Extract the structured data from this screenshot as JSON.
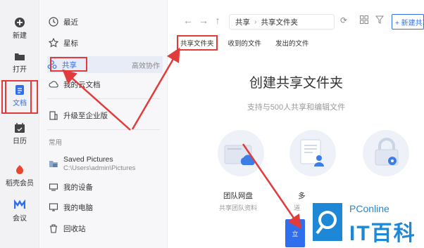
{
  "rail": {
    "items": [
      {
        "label": "新建",
        "icon": "plus-circle-icon"
      },
      {
        "label": "打开",
        "icon": "folder-icon"
      },
      {
        "label": "文档",
        "icon": "document-icon"
      },
      {
        "label": "日历",
        "icon": "calendar-icon"
      },
      {
        "label": "稻壳会员",
        "icon": "member-icon"
      },
      {
        "label": "会议",
        "icon": "meeting-icon"
      }
    ]
  },
  "sidebar": {
    "items": [
      {
        "label": "最近",
        "icon": "clock-icon"
      },
      {
        "label": "星标",
        "icon": "star-icon"
      },
      {
        "label": "共享",
        "icon": "share-icon",
        "extra": "高效协作"
      },
      {
        "label": "我的云文档",
        "icon": "cloud-icon"
      },
      {
        "label": "升级至企业版",
        "icon": "building-icon"
      }
    ],
    "section_label": "常用",
    "section_more": "⋮",
    "common": [
      {
        "label": "Saved Pictures",
        "sub": "C:\\Users\\admin\\Pictures",
        "icon": "pictures-folder-icon"
      },
      {
        "label": "我的设备",
        "icon": "device-icon"
      },
      {
        "label": "我的电脑",
        "icon": "computer-icon"
      },
      {
        "label": "回收站",
        "icon": "trash-icon"
      }
    ]
  },
  "toolbar": {
    "crumbs": [
      "共享",
      "共享文件夹"
    ],
    "crumb_sep": "›",
    "new_folder_label": "+ 新建共享"
  },
  "tabs": [
    "共享文件夹",
    "收到的文件",
    "发出的文件"
  ],
  "hero": {
    "title": "创建共享文件夹",
    "subtitle": "支持与500人共享和编辑文件"
  },
  "cards": [
    {
      "title": "团队网盘",
      "sub": "共享团队资料"
    },
    {
      "title": "多",
      "sub": "道"
    },
    {
      "title": "",
      "sub": ""
    }
  ],
  "cta": {
    "label": "立"
  },
  "watermark": {
    "top": "PConline",
    "big": "IT百科"
  },
  "colors": {
    "accent": "#2f6fed",
    "annotation": "#e23b3b",
    "watermark": "#1e88d7"
  }
}
